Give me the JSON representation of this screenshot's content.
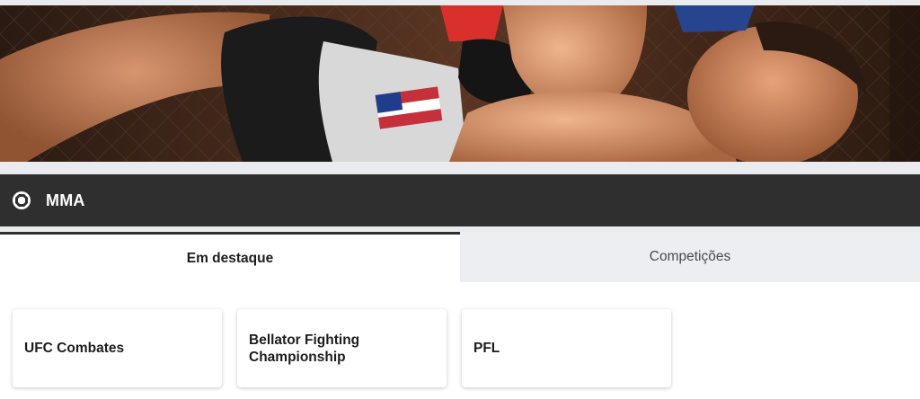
{
  "hero": {
    "image_description_icon": "mma-fight-photo"
  },
  "sport_header": {
    "icon": "octagon-icon",
    "title": "MMA"
  },
  "tabs": [
    {
      "label": "Em destaque",
      "active": true
    },
    {
      "label": "Competições",
      "active": false
    }
  ],
  "competitions": [
    {
      "label": "UFC Combates"
    },
    {
      "label": "Bellator Fighting Championship"
    },
    {
      "label": "PFL"
    }
  ],
  "colors": {
    "header_bg": "#2f2f2f",
    "tab_inactive_bg": "#eceef1",
    "page_bg": "#e9ebee"
  }
}
